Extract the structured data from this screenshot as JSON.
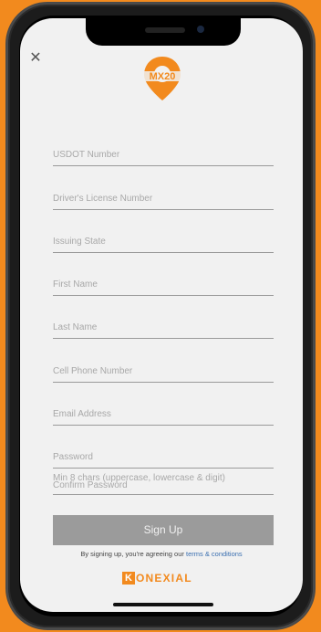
{
  "app": {
    "logo_text": "MX20",
    "close_glyph": "✕",
    "accent_color": "#f28a1e",
    "link_color": "#3a6fb0"
  },
  "form": {
    "fields": [
      {
        "placeholder": "USDOT Number",
        "value": ""
      },
      {
        "placeholder": "Driver's License Number",
        "value": ""
      },
      {
        "placeholder": "Issuing State",
        "value": ""
      },
      {
        "placeholder": "First Name",
        "value": ""
      },
      {
        "placeholder": "Last Name",
        "value": ""
      },
      {
        "placeholder": "Cell Phone Number",
        "value": ""
      },
      {
        "placeholder": "Email Address",
        "value": ""
      },
      {
        "placeholder": "Password",
        "value": ""
      }
    ],
    "password_hint": "Min 8 chars (uppercase, lowercase & digit)",
    "confirm_password_placeholder": "Confirm Password"
  },
  "actions": {
    "signup_label": "Sign Up"
  },
  "footer": {
    "terms_prefix": "By signing up, you're agreeing our ",
    "terms_link": "terms & conditions",
    "brand_letter": "K",
    "brand_rest": "ONEXIAL"
  }
}
